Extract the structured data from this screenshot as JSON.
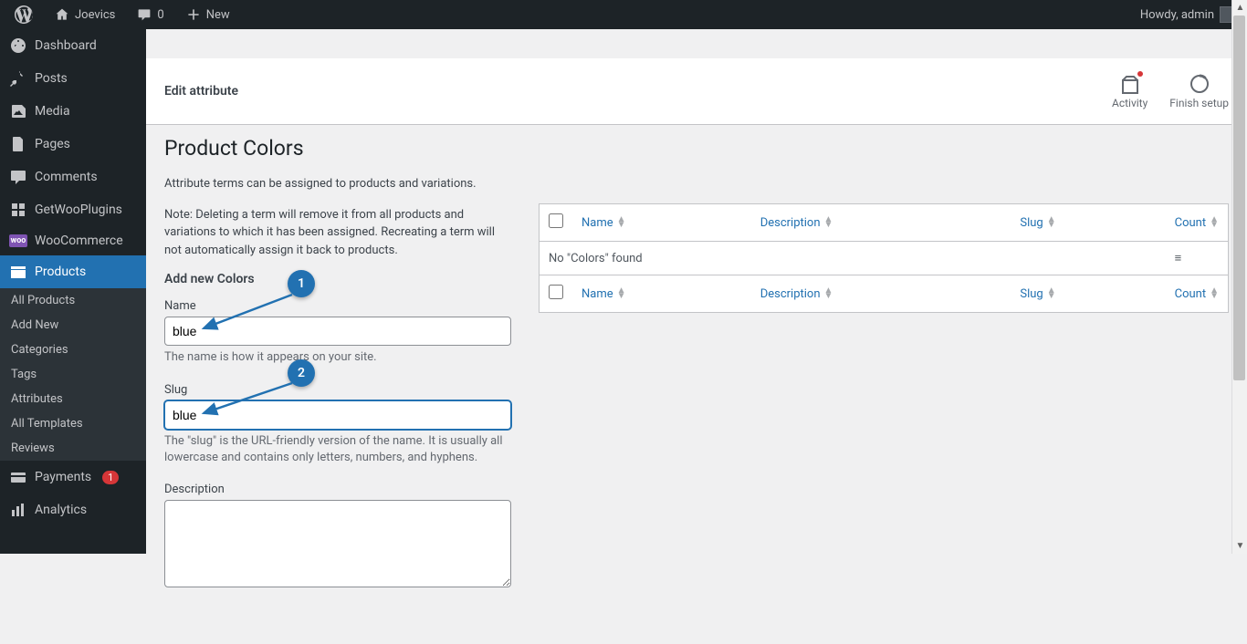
{
  "admin_bar": {
    "site_name": "Joevics",
    "comments_count": "0",
    "new_label": "New",
    "howdy": "Howdy, admin"
  },
  "sidebar": {
    "dashboard": "Dashboard",
    "posts": "Posts",
    "media": "Media",
    "pages": "Pages",
    "comments": "Comments",
    "getwooplugins": "GetWooPlugins",
    "woocommerce": "WooCommerce",
    "products": "Products",
    "submenu": {
      "all_products": "All Products",
      "add_new": "Add New",
      "categories": "Categories",
      "tags": "Tags",
      "attributes": "Attributes",
      "all_templates": "All Templates",
      "reviews": "Reviews"
    },
    "payments": "Payments",
    "payments_badge": "1",
    "analytics": "Analytics"
  },
  "header": {
    "title": "Edit attribute",
    "activity": "Activity",
    "finish_setup": "Finish setup"
  },
  "page": {
    "heading": "Product Colors",
    "help1": "Attribute terms can be assigned to products and variations.",
    "help2": "Note: Deleting a term will remove it from all products and variations to which it has been assigned. Recreating a term will not automatically assign it back to products.",
    "add_heading": "Add new Colors",
    "name_label": "Name",
    "name_value": "blue",
    "name_desc": "The name is how it appears on your site.",
    "slug_label": "Slug",
    "slug_value": "blue",
    "slug_desc": "The \"slug\" is the URL-friendly version of the name. It is usually all lowercase and contains only letters, numbers, and hyphens.",
    "description_label": "Description"
  },
  "table": {
    "col_name": "Name",
    "col_description": "Description",
    "col_slug": "Slug",
    "col_count": "Count",
    "no_items": "No \"Colors\" found"
  },
  "annotations": {
    "marker1": "1",
    "marker2": "2"
  }
}
